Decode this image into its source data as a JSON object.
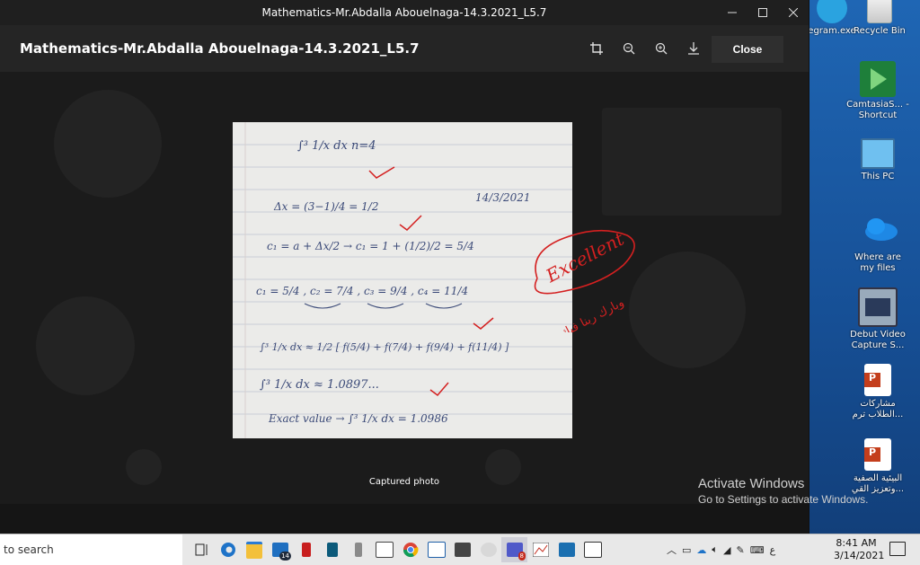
{
  "window": {
    "title": "Mathematics-Mr.Abdalla Abouelnaga-14.3.2021_L5.7"
  },
  "viewer": {
    "doc_title": "Mathematics-Mr.Abdalla Abouelnaga-14.3.2021_L5.7",
    "tools": [
      "crop-icon",
      "zoom-out-icon",
      "zoom-in-icon",
      "download-icon"
    ],
    "close_label": "Close",
    "caption": "Captured photo"
  },
  "photo": {
    "line1": "∫³ 1/x dx        n=4",
    "date": "14/3/2021",
    "line2": "Δx = (3−1)/4 = 1/2",
    "line3": "c₁ = a + Δx/2 → c₁ = 1 + (1/2)/2 = 5/4",
    "line4": "c₁ = 5/4 , c₂ = 7/4 , c₃ = 9/4 , c₄ = 11/4",
    "line5": "∫³ 1/x dx ≈ 1/2 [ f(5/4) + f(7/4) + f(9/4) + f(11/4) ]",
    "line6": "∫³ 1/x dx ≈ 1.0897...",
    "line7": "Exact value → ∫³ 1/x dx = 1.0986",
    "teacher_note": "Excellent",
    "teacher_arabic": "وبارك ربنا فيك"
  },
  "activation": {
    "title": "Activate Windows",
    "subtitle": "Go to Settings to activate Windows."
  },
  "desktop": {
    "icons": [
      {
        "label": "egram.exe",
        "icon": "telegram-icon"
      },
      {
        "label": "Recycle Bin",
        "icon": "recycle-bin-icon"
      },
      {
        "label": "CamtasiaS... - Shortcut",
        "icon": "camtasia-icon"
      },
      {
        "label": "This PC",
        "icon": "this-pc-icon"
      },
      {
        "label": "Where are my files",
        "icon": "onedrive-icon"
      },
      {
        "label": "Debut Video Capture S...",
        "icon": "debut-video-icon"
      },
      {
        "label": "مشاركات الطلاب ترم...",
        "icon": "powerpoint-icon"
      },
      {
        "label": "البيئية الصفية وتعزيز القي...",
        "icon": "powerpoint-icon"
      }
    ]
  },
  "taskbar": {
    "search_placeholder": "to search",
    "mail_badge": "14",
    "teams_badge": "8",
    "lang": "ع",
    "time": "8:41 AM",
    "date": "3/14/2021"
  },
  "colors": {
    "accent": "#1a5aa5",
    "ink_red": "#d42020"
  }
}
